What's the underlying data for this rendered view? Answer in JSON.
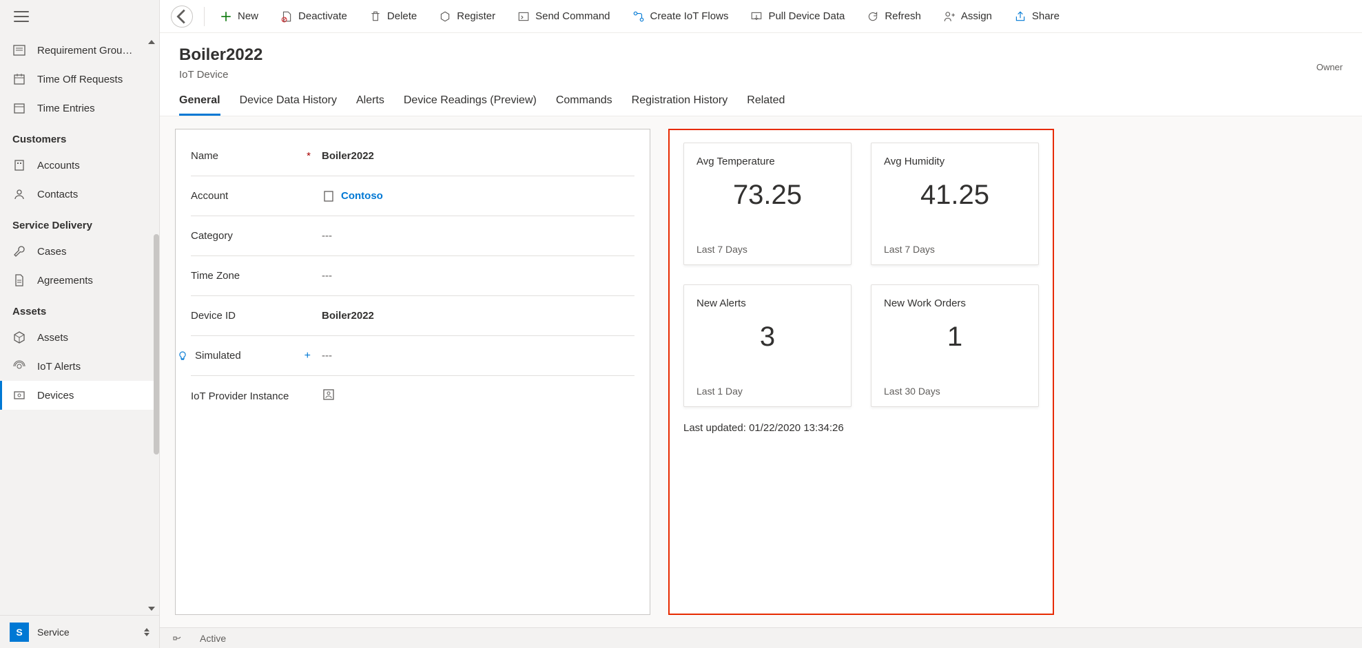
{
  "sidebar": {
    "top_items": [
      {
        "label": "Requirement Grou…"
      },
      {
        "label": "Time Off Requests"
      },
      {
        "label": "Time Entries"
      }
    ],
    "groups": [
      {
        "header": "Customers",
        "items": [
          {
            "label": "Accounts"
          },
          {
            "label": "Contacts"
          }
        ]
      },
      {
        "header": "Service Delivery",
        "items": [
          {
            "label": "Cases"
          },
          {
            "label": "Agreements"
          }
        ]
      },
      {
        "header": "Assets",
        "items": [
          {
            "label": "Assets"
          },
          {
            "label": "IoT Alerts"
          },
          {
            "label": "Devices",
            "active": true
          }
        ]
      }
    ],
    "footer": {
      "badge": "S",
      "label": "Service"
    }
  },
  "toolbar": {
    "new": "New",
    "deactivate": "Deactivate",
    "delete": "Delete",
    "register": "Register",
    "send_command": "Send Command",
    "create_flows": "Create IoT Flows",
    "pull_data": "Pull Device Data",
    "refresh": "Refresh",
    "assign": "Assign",
    "share": "Share"
  },
  "header": {
    "title": "Boiler2022",
    "subtitle": "IoT Device",
    "owner_label": "Owner"
  },
  "tabs": [
    "General",
    "Device Data History",
    "Alerts",
    "Device Readings (Preview)",
    "Commands",
    "Registration History",
    "Related"
  ],
  "form": {
    "name": {
      "label": "Name",
      "value": "Boiler2022"
    },
    "account": {
      "label": "Account",
      "value": "Contoso"
    },
    "category": {
      "label": "Category",
      "value": "---"
    },
    "timezone": {
      "label": "Time Zone",
      "value": "---"
    },
    "device_id": {
      "label": "Device ID",
      "value": "Boiler2022"
    },
    "simulated": {
      "label": "Simulated",
      "value": "---"
    },
    "provider": {
      "label": "IoT Provider Instance",
      "value": ""
    }
  },
  "summary": {
    "cards": [
      {
        "title": "Avg Temperature",
        "value": "73.25",
        "sub": "Last 7 Days"
      },
      {
        "title": "Avg Humidity",
        "value": "41.25",
        "sub": "Last 7 Days"
      },
      {
        "title": "New Alerts",
        "value": "3",
        "sub": "Last 1 Day"
      },
      {
        "title": "New Work Orders",
        "value": "1",
        "sub": "Last 30 Days"
      }
    ],
    "last_updated": "Last updated: 01/22/2020 13:34:26"
  },
  "footer": {
    "status": "Active"
  }
}
